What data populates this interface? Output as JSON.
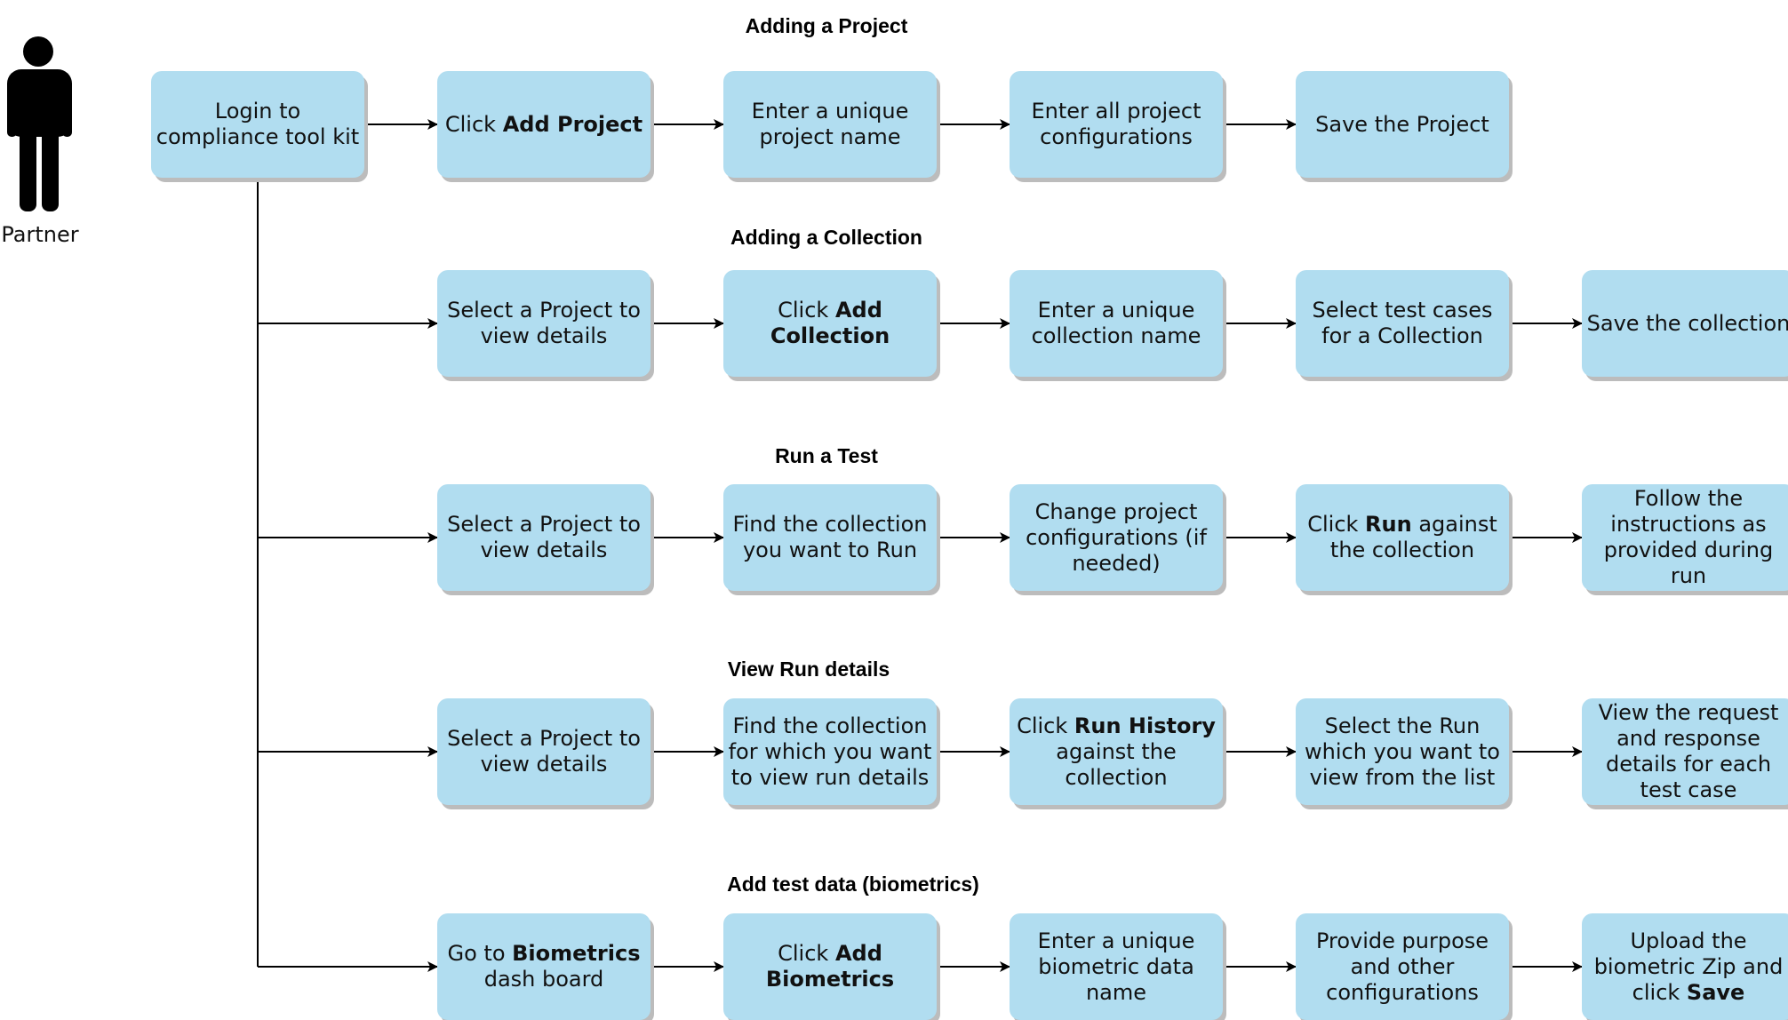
{
  "actor": {
    "label": "Partner",
    "icon": "person-icon"
  },
  "login": {
    "before": "Login to compliance tool kit",
    "bold": "",
    "after": ""
  },
  "sections": [
    {
      "title": "Adding a Project",
      "steps": [
        {
          "before": "Click ",
          "bold": "Add Project",
          "after": ""
        },
        {
          "before": "Enter a unique project name",
          "bold": "",
          "after": ""
        },
        {
          "before": "Enter all project configurations",
          "bold": "",
          "after": ""
        },
        {
          "before": "Save the Project",
          "bold": "",
          "after": ""
        }
      ]
    },
    {
      "title": "Adding a Collection",
      "steps": [
        {
          "before": "Select a Project to view details",
          "bold": "",
          "after": ""
        },
        {
          "before": "Click ",
          "bold": "Add Collection",
          "after": ""
        },
        {
          "before": "Enter a unique collection name",
          "bold": "",
          "after": ""
        },
        {
          "before": "Select test cases for a Collection",
          "bold": "",
          "after": ""
        },
        {
          "before": "Save the collection",
          "bold": "",
          "after": ""
        }
      ]
    },
    {
      "title": "Run a Test",
      "steps": [
        {
          "before": "Select a Project to view details",
          "bold": "",
          "after": ""
        },
        {
          "before": "Find the collection you want to Run",
          "bold": "",
          "after": ""
        },
        {
          "before": "Change project configurations (if needed)",
          "bold": "",
          "after": ""
        },
        {
          "before": "Click ",
          "bold": "Run",
          "after": " against the collection"
        },
        {
          "before": "Follow the instructions as provided during run",
          "bold": "",
          "after": ""
        }
      ]
    },
    {
      "title": "View Run details",
      "steps": [
        {
          "before": "Select a Project to view details",
          "bold": "",
          "after": ""
        },
        {
          "before": "Find the collection for which you want to view run details",
          "bold": "",
          "after": ""
        },
        {
          "before": "Click ",
          "bold": "Run History",
          "after": " against the collection"
        },
        {
          "before": "Select the Run which you want to view from the list",
          "bold": "",
          "after": ""
        },
        {
          "before": "View the request and response details for each test case",
          "bold": "",
          "after": ""
        }
      ]
    },
    {
      "title": "Add test data (biometrics)",
      "steps": [
        {
          "before": "Go to ",
          "bold": "Biometrics",
          "after": " dash board"
        },
        {
          "before": "Click ",
          "bold": "Add Biometrics",
          "after": ""
        },
        {
          "before": "Enter a unique biometric data name",
          "bold": "",
          "after": ""
        },
        {
          "before": "Provide purpose and other configurations",
          "bold": "",
          "after": ""
        },
        {
          "before": "Upload the biometric Zip and click ",
          "bold": "Save",
          "after": ""
        }
      ]
    }
  ],
  "colors": {
    "box_fill": "#b1ddf0",
    "shadow": "#bcbcbc",
    "line": "#000000"
  }
}
